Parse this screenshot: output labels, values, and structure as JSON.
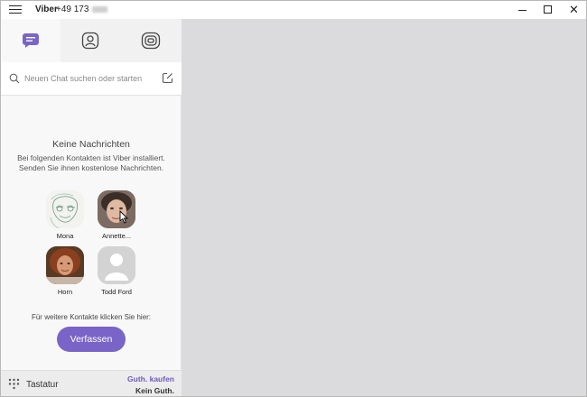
{
  "titlebar": {
    "app_name": "Viber",
    "phone_prefix": "+49 173"
  },
  "tabs": [
    {
      "name": "chats",
      "icon": "chat-bubble-icon",
      "active": true
    },
    {
      "name": "contacts",
      "icon": "contact-icon",
      "active": false
    },
    {
      "name": "public",
      "icon": "public-chats-icon",
      "active": false
    }
  ],
  "search": {
    "placeholder": "Neuen Chat suchen oder starten"
  },
  "empty_state": {
    "title": "Keine Nachrichten",
    "line1": "Bei folgenden Kontakten ist Viber installiert.",
    "line2": "Senden Sie ihnen kostenlose Nachrichten."
  },
  "contacts": [
    {
      "name": "Mona"
    },
    {
      "name": "Annette..."
    },
    {
      "name": "Horn"
    },
    {
      "name": "Todd Ford"
    }
  ],
  "more_contacts_text": "Für weitere Kontakte klicken Sie hier:",
  "compose_button": "Verfassen",
  "bottom": {
    "keypad_label": "Tastatur",
    "buy_credit": "Guth. kaufen",
    "credit_status": "Kein Guth."
  },
  "colors": {
    "accent": "#7a64c7",
    "main_background": "#dbdbdd",
    "sidebar_background": "#f8f8f8"
  }
}
